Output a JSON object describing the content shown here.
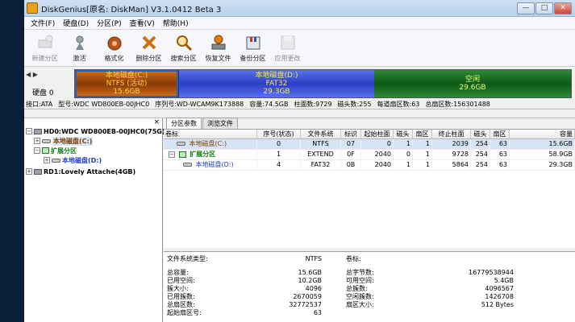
{
  "window": {
    "title": "DiskGenius[原名: DiskMan] V3.1.0412 Beta 3",
    "buttons": [
      "—",
      "□",
      "✕"
    ]
  },
  "menu": [
    "文件(F)",
    "硬盘(D)",
    "分区(P)",
    "查看(V)",
    "帮助(H)"
  ],
  "toolbar": [
    {
      "label": "新建分区",
      "icon": "new-partition-icon",
      "enabled": false
    },
    {
      "label": "激活",
      "icon": "activate-icon",
      "enabled": true
    },
    {
      "label": "格式化",
      "icon": "format-icon",
      "enabled": true
    },
    {
      "label": "删除分区",
      "icon": "delete-partition-icon",
      "enabled": true
    },
    {
      "label": "搜索分区",
      "icon": "search-partition-icon",
      "enabled": true
    },
    {
      "label": "恢复文件",
      "icon": "recover-files-icon",
      "enabled": true
    },
    {
      "label": "备份分区",
      "icon": "backup-partition-icon",
      "enabled": true
    },
    {
      "label": "应用更改",
      "icon": "apply-changes-icon",
      "enabled": false
    }
  ],
  "disk_map": {
    "disk_label": "硬盘 0",
    "nav": "◀ ▶",
    "partitions": [
      {
        "name": "本地磁盘(C:)",
        "fs": "NTFS (活动)",
        "size": "15.6GB",
        "color": "#a04c0c"
      },
      {
        "name": "本地磁盘(D:)",
        "fs": "FAT32",
        "size": "29.3GB",
        "color": "#3a52d4"
      },
      {
        "name": "空闲",
        "fs": "",
        "size": "29.6GB",
        "color": "#1f7428"
      }
    ]
  },
  "disk_info": [
    "接口:ATA",
    "型号:WDC WD800EB-00JHC0",
    "序列号:WD-WCAM9K173888",
    "容量:74.5GB",
    "柱面数:9729",
    "磁头数:255",
    "每道扇区数:63",
    "总扇区数:156301488"
  ],
  "tree": {
    "close": "×",
    "nodes": [
      {
        "text": "HD0:WDC WD800EB-00JHC0(75G)",
        "level": 0
      },
      {
        "text": "本地磁盘(C:)",
        "level": 1
      },
      {
        "text": "扩展分区",
        "level": 1
      },
      {
        "text": "本地磁盘(D:)",
        "level": 2
      },
      {
        "text": "RD1:Lovely Attache(4GB)",
        "level": 0
      }
    ]
  },
  "tabs": [
    "分区参数",
    "浏览文件"
  ],
  "partition_table": {
    "headers": [
      "卷标",
      "序号(状态)",
      "文件系统",
      "标识",
      "起始柱面",
      "磁头",
      "扇区",
      "终止柱面",
      "磁头",
      "扇区",
      "容量"
    ],
    "rows": [
      [
        "本地磁盘(C:)",
        "0",
        "NTFS",
        "07",
        "0",
        "1",
        "1",
        "2039",
        "254",
        "63",
        "15.6GB"
      ],
      [
        "扩展分区",
        "1",
        "EXTEND",
        "0F",
        "2040",
        "0",
        "1",
        "9728",
        "254",
        "63",
        "58.9GB"
      ],
      [
        "本地磁盘(D:)",
        "4",
        "FAT32",
        "0B",
        "2040",
        "1",
        "1",
        "5864",
        "254",
        "63",
        "29.3GB"
      ]
    ]
  },
  "details": {
    "fs_type_label": "文件系统类型:",
    "fs_type_value": "NTFS",
    "volume_label_label": "卷标:",
    "volume_label_value": "",
    "left": [
      {
        "label": "总容量:",
        "value": "15.6GB"
      },
      {
        "label": "已用空间:",
        "value": "10.2GB"
      },
      {
        "label": "簇大小:",
        "value": "4096"
      },
      {
        "label": "已用簇数:",
        "value": "2670059"
      },
      {
        "label": "总扇区数:",
        "value": "32772537"
      },
      {
        "label": "起始扇区号:",
        "value": "63"
      }
    ],
    "right": [
      {
        "label": "总字节数:",
        "value": "16779538944"
      },
      {
        "label": "可用空间:",
        "value": "5.4GB"
      },
      {
        "label": "总簇数:",
        "value": "4096567"
      },
      {
        "label": "空闲簇数:",
        "value": "1426708"
      },
      {
        "label": "扇区大小:",
        "value": "512 Bytes"
      }
    ]
  }
}
